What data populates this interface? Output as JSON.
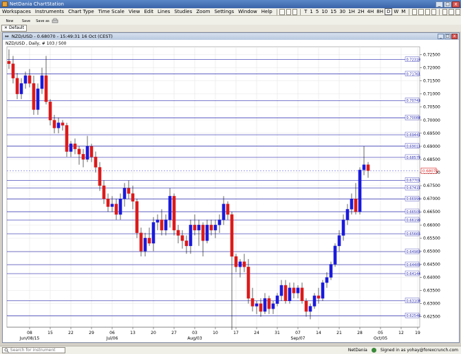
{
  "window": {
    "title": "NetDania ChartStation",
    "minimize": "_",
    "maximize": "□",
    "close": "x"
  },
  "menu": [
    "Workspaces",
    "Instruments",
    "Chart Type",
    "Time Scale",
    "View",
    "Edit",
    "Lines",
    "Studies",
    "Zoom",
    "Settings",
    "Window",
    "Help"
  ],
  "timescale": [
    "T",
    "1",
    "5",
    "10",
    "15",
    "30",
    "1H",
    "2H",
    "4H",
    "8H",
    "D",
    "W",
    "M"
  ],
  "timescale_active": "D",
  "toolbar2": {
    "new": "New",
    "save": "Save",
    "save_as": "Save as"
  },
  "workspace_tab": "Default",
  "chart_window": {
    "title": "NZD/USD - 0.68070 - 15:49:31 16 Oct (CEST)",
    "legend": "NZD/USD , Daily, # 103 / 500"
  },
  "status": {
    "search_placeholder": "Search for instrument",
    "brand": "NetDania",
    "signed_in": "Signed in as yohay@forexcrunch.com"
  },
  "colors": {
    "up": "#1a1adc",
    "down": "#dc1a1a",
    "hline": "#2a2ab0",
    "grid": "#e4e4e4"
  },
  "chart_data": {
    "type": "candlestick",
    "instrument": "NZD/USD",
    "timeframe": "Daily",
    "ylim": [
      0.621,
      0.728
    ],
    "yticks": [
      0.725,
      0.72,
      0.715,
      0.71,
      0.705,
      0.7,
      0.695,
      0.69,
      0.685,
      0.68,
      0.675,
      0.67,
      0.665,
      0.66,
      0.655,
      0.65,
      0.645,
      0.64,
      0.635,
      0.63,
      0.625
    ],
    "ytick_labels": [
      "0.72500",
      "0.72000",
      "0.71500",
      "0.71000",
      "0.70500",
      "0.70000",
      "0.69500",
      "0.69000",
      "0.68500",
      "0.68000",
      "0.67500",
      "0.67000",
      "0.66500",
      "0.66000",
      "0.65500",
      "0.65000",
      "0.64500",
      "0.64000",
      "0.63500",
      "0.63000",
      "0.62500"
    ],
    "hlines": [
      {
        "value": 0.7231,
        "label": "0.72310"
      },
      {
        "value": 0.71761,
        "label": "0.71761"
      },
      {
        "value": 0.70743,
        "label": "0.70743"
      },
      {
        "value": 0.70088,
        "label": "0.70088"
      },
      {
        "value": 0.69441,
        "label": "0.69441"
      },
      {
        "value": 0.69011,
        "label": "0.69011"
      },
      {
        "value": 0.68579,
        "label": "0.68579"
      },
      {
        "value": 0.67701,
        "label": "0.67701"
      },
      {
        "value": 0.67415,
        "label": "0.67415"
      },
      {
        "value": 0.66994,
        "label": "0.66994"
      },
      {
        "value": 0.66505,
        "label": "0.66505"
      },
      {
        "value": 0.6619,
        "label": "0.66190"
      },
      {
        "value": 0.65665,
        "label": "0.65665"
      },
      {
        "value": 0.64983,
        "label": "0.64983"
      },
      {
        "value": 0.64485,
        "label": "0.64485"
      },
      {
        "value": 0.64144,
        "label": "0.64144"
      },
      {
        "value": 0.63108,
        "label": "0.63108"
      },
      {
        "value": 0.6254,
        "label": "0.62540"
      }
    ],
    "current_price": {
      "value": 0.6807,
      "label": "0.68070"
    },
    "xticks": [
      {
        "index": 5,
        "label": "08",
        "month": "Jun/08/15"
      },
      {
        "index": 10,
        "label": "15"
      },
      {
        "index": 15,
        "label": "22"
      },
      {
        "index": 20,
        "label": "29"
      },
      {
        "index": 25,
        "label": "06",
        "month": "Jul/06"
      },
      {
        "index": 30,
        "label": "13"
      },
      {
        "index": 35,
        "label": "20"
      },
      {
        "index": 40,
        "label": "27"
      },
      {
        "index": 45,
        "label": "03",
        "month": "Aug/03"
      },
      {
        "index": 50,
        "label": "10"
      },
      {
        "index": 55,
        "label": "17"
      },
      {
        "index": 60,
        "label": "24"
      },
      {
        "index": 65,
        "label": "31"
      },
      {
        "index": 70,
        "label": "07",
        "month": "Sep/07"
      },
      {
        "index": 75,
        "label": "14"
      },
      {
        "index": 80,
        "label": "21"
      },
      {
        "index": 85,
        "label": "28"
      },
      {
        "index": 90,
        "label": "05",
        "month": "Oct/05"
      },
      {
        "index": 95,
        "label": "12"
      },
      {
        "index": 99,
        "label": "19"
      }
    ],
    "candles": [
      [
        0.7225,
        0.727,
        0.7195,
        0.7215
      ],
      [
        0.7215,
        0.7245,
        0.714,
        0.716
      ],
      [
        0.716,
        0.718,
        0.708,
        0.71
      ],
      [
        0.71,
        0.716,
        0.708,
        0.714
      ],
      [
        0.714,
        0.7185,
        0.712,
        0.717
      ],
      [
        0.717,
        0.7195,
        0.7125,
        0.714
      ],
      [
        0.714,
        0.717,
        0.702,
        0.704
      ],
      [
        0.704,
        0.714,
        0.702,
        0.712
      ],
      [
        0.712,
        0.72,
        0.71,
        0.717
      ],
      [
        0.717,
        0.7245,
        0.706,
        0.707
      ],
      [
        0.707,
        0.708,
        0.698,
        0.7
      ],
      [
        0.7,
        0.702,
        0.695,
        0.697
      ],
      [
        0.697,
        0.701,
        0.695,
        0.699
      ],
      [
        0.699,
        0.7,
        0.696,
        0.698
      ],
      [
        0.698,
        0.699,
        0.686,
        0.688
      ],
      [
        0.688,
        0.692,
        0.686,
        0.691
      ],
      [
        0.691,
        0.693,
        0.687,
        0.689
      ],
      [
        0.689,
        0.69,
        0.683,
        0.687
      ],
      [
        0.687,
        0.689,
        0.682,
        0.685
      ],
      [
        0.685,
        0.694,
        0.684,
        0.69
      ],
      [
        0.69,
        0.691,
        0.684,
        0.686
      ],
      [
        0.686,
        0.688,
        0.68,
        0.682
      ],
      [
        0.682,
        0.684,
        0.673,
        0.675
      ],
      [
        0.675,
        0.677,
        0.668,
        0.67
      ],
      [
        0.67,
        0.672,
        0.665,
        0.667
      ],
      [
        0.667,
        0.671,
        0.665,
        0.668
      ],
      [
        0.668,
        0.67,
        0.662,
        0.664
      ],
      [
        0.664,
        0.672,
        0.662,
        0.67
      ],
      [
        0.67,
        0.676,
        0.667,
        0.674
      ],
      [
        0.674,
        0.677,
        0.67,
        0.672
      ],
      [
        0.672,
        0.675,
        0.666,
        0.669
      ],
      [
        0.669,
        0.67,
        0.655,
        0.657
      ],
      [
        0.657,
        0.659,
        0.648,
        0.65
      ],
      [
        0.65,
        0.657,
        0.648,
        0.655
      ],
      [
        0.655,
        0.659,
        0.652,
        0.653
      ],
      [
        0.653,
        0.663,
        0.65,
        0.661
      ],
      [
        0.661,
        0.664,
        0.658,
        0.662
      ],
      [
        0.662,
        0.666,
        0.656,
        0.658
      ],
      [
        0.658,
        0.664,
        0.656,
        0.662
      ],
      [
        0.662,
        0.674,
        0.659,
        0.671
      ],
      [
        0.671,
        0.672,
        0.656,
        0.658
      ],
      [
        0.658,
        0.66,
        0.653,
        0.656
      ],
      [
        0.656,
        0.658,
        0.651,
        0.654
      ],
      [
        0.654,
        0.656,
        0.649,
        0.652
      ],
      [
        0.652,
        0.662,
        0.649,
        0.66
      ],
      [
        0.66,
        0.664,
        0.656,
        0.658
      ],
      [
        0.658,
        0.662,
        0.652,
        0.66
      ],
      [
        0.66,
        0.661,
        0.648,
        0.654
      ],
      [
        0.654,
        0.662,
        0.653,
        0.66
      ],
      [
        0.66,
        0.662,
        0.656,
        0.658
      ],
      [
        0.658,
        0.662,
        0.655,
        0.66
      ],
      [
        0.66,
        0.664,
        0.657,
        0.662
      ],
      [
        0.662,
        0.671,
        0.66,
        0.668
      ],
      [
        0.668,
        0.669,
        0.662,
        0.664
      ],
      [
        0.664,
        0.665,
        0.62,
        0.648
      ],
      [
        0.648,
        0.649,
        0.642,
        0.644
      ],
      [
        0.644,
        0.647,
        0.64,
        0.646
      ],
      [
        0.646,
        0.649,
        0.642,
        0.644
      ],
      [
        0.644,
        0.647,
        0.63,
        0.632
      ],
      [
        0.632,
        0.636,
        0.627,
        0.629
      ],
      [
        0.629,
        0.631,
        0.626,
        0.63
      ],
      [
        0.63,
        0.632,
        0.625,
        0.627
      ],
      [
        0.627,
        0.634,
        0.626,
        0.632
      ],
      [
        0.632,
        0.633,
        0.626,
        0.628
      ],
      [
        0.628,
        0.631,
        0.626,
        0.63
      ],
      [
        0.63,
        0.634,
        0.629,
        0.633
      ],
      [
        0.633,
        0.639,
        0.631,
        0.637
      ],
      [
        0.637,
        0.639,
        0.63,
        0.631
      ],
      [
        0.631,
        0.638,
        0.63,
        0.636
      ],
      [
        0.636,
        0.638,
        0.632,
        0.634
      ],
      [
        0.634,
        0.637,
        0.632,
        0.636
      ],
      [
        0.636,
        0.638,
        0.63,
        0.631
      ],
      [
        0.631,
        0.632,
        0.625,
        0.627
      ],
      [
        0.627,
        0.63,
        0.624,
        0.629
      ],
      [
        0.629,
        0.634,
        0.628,
        0.633
      ],
      [
        0.633,
        0.636,
        0.63,
        0.632
      ],
      [
        0.632,
        0.639,
        0.631,
        0.638
      ],
      [
        0.638,
        0.642,
        0.636,
        0.64
      ],
      [
        0.64,
        0.646,
        0.639,
        0.645
      ],
      [
        0.645,
        0.653,
        0.644,
        0.652
      ],
      [
        0.652,
        0.658,
        0.65,
        0.656
      ],
      [
        0.656,
        0.664,
        0.654,
        0.662
      ],
      [
        0.662,
        0.668,
        0.66,
        0.666
      ],
      [
        0.666,
        0.672,
        0.664,
        0.67
      ],
      [
        0.67,
        0.676,
        0.664,
        0.665
      ],
      [
        0.665,
        0.682,
        0.664,
        0.681
      ],
      [
        0.681,
        0.69,
        0.679,
        0.683
      ],
      [
        0.683,
        0.684,
        0.678,
        0.6807
      ]
    ]
  }
}
